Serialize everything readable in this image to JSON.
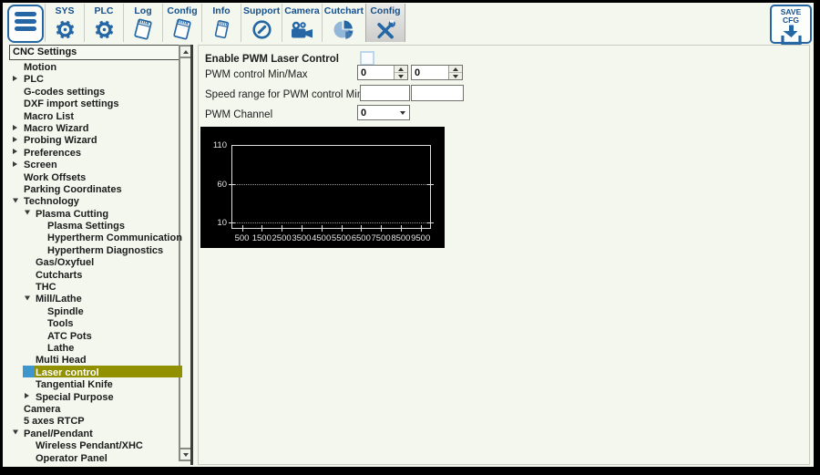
{
  "colors": {
    "accent_blue": "#2566a5",
    "toolbar_label_blue": "#17508c",
    "selection_olive": "#919100",
    "selection_blue": "#3d96cc",
    "app_background": "#f3f7ee",
    "chart_background": "#000000"
  },
  "toolbar": {
    "menu_button": {
      "icon": "menu"
    },
    "buttons": [
      {
        "id": "sys",
        "label": "SYS",
        "icon": "gear"
      },
      {
        "id": "plc",
        "label": "PLC",
        "icon": "gear"
      },
      {
        "id": "log",
        "label": "Log",
        "icon": "notepad"
      },
      {
        "id": "config",
        "label": "Config",
        "icon": "notepad"
      },
      {
        "id": "info",
        "label": "Info",
        "icon": "notepad-small"
      },
      {
        "id": "support",
        "label": "Support",
        "icon": "support-dial"
      },
      {
        "id": "camera",
        "label": "Camera",
        "icon": "camera"
      },
      {
        "id": "cutchart",
        "label": "Cutchart",
        "icon": "pie-chart"
      },
      {
        "id": "config-tools",
        "label": "Config",
        "icon": "tools",
        "selected": true
      }
    ],
    "save_button": {
      "label": "SAVE CFG",
      "icon": "save-arrow"
    }
  },
  "sidebar": {
    "header": "CNC Settings",
    "items": [
      {
        "label": "Motion",
        "level": 0,
        "arrow": null
      },
      {
        "label": "PLC",
        "level": 0,
        "arrow": "right"
      },
      {
        "label": "G-codes settings",
        "level": 0,
        "arrow": null
      },
      {
        "label": "DXF import settings",
        "level": 0,
        "arrow": null
      },
      {
        "label": "Macro List",
        "level": 0,
        "arrow": null
      },
      {
        "label": "Macro Wizard",
        "level": 0,
        "arrow": "right"
      },
      {
        "label": "Probing Wizard",
        "level": 0,
        "arrow": "right"
      },
      {
        "label": "Preferences",
        "level": 0,
        "arrow": "right"
      },
      {
        "label": "Screen",
        "level": 0,
        "arrow": "right"
      },
      {
        "label": "Work Offsets",
        "level": 0,
        "arrow": null
      },
      {
        "label": "Parking Coordinates",
        "level": 0,
        "arrow": null
      },
      {
        "label": "Technology",
        "level": 0,
        "arrow": "down"
      },
      {
        "label": "Plasma Cutting",
        "level": 1,
        "arrow": "down"
      },
      {
        "label": "Plasma Settings",
        "level": 2,
        "arrow": null
      },
      {
        "label": "Hypertherm Communication",
        "level": 2,
        "arrow": null
      },
      {
        "label": "Hypertherm Diagnostics",
        "level": 2,
        "arrow": null
      },
      {
        "label": "Gas/Oxyfuel",
        "level": 1,
        "arrow": null
      },
      {
        "label": "Cutcharts",
        "level": 1,
        "arrow": null
      },
      {
        "label": "THC",
        "level": 1,
        "arrow": null
      },
      {
        "label": "Mill/Lathe",
        "level": 1,
        "arrow": "down"
      },
      {
        "label": "Spindle",
        "level": 2,
        "arrow": null
      },
      {
        "label": "Tools",
        "level": 2,
        "arrow": null
      },
      {
        "label": "ATC Pots",
        "level": 2,
        "arrow": null
      },
      {
        "label": "Lathe",
        "level": 2,
        "arrow": null
      },
      {
        "label": "Multi Head",
        "level": 1,
        "arrow": null
      },
      {
        "label": "Laser control",
        "level": 1,
        "arrow": null,
        "selected": true
      },
      {
        "label": "Tangential Knife",
        "level": 1,
        "arrow": null
      },
      {
        "label": "Special Purpose",
        "level": 1,
        "arrow": "right"
      },
      {
        "label": "Camera",
        "level": 0,
        "arrow": null
      },
      {
        "label": "5 axes RTCP",
        "level": 0,
        "arrow": null
      },
      {
        "label": "Panel/Pendant",
        "level": 0,
        "arrow": "down"
      },
      {
        "label": "Wireless Pendant/XHC",
        "level": 1,
        "arrow": null
      },
      {
        "label": "Operator Panel",
        "level": 1,
        "arrow": null
      }
    ]
  },
  "panel": {
    "enable_label": "Enable PWM Laser Control",
    "enable_checked": false,
    "pwm_minmax_label": "PWM control Min/Max",
    "pwm_min": "0",
    "pwm_max": "0",
    "speed_range_label": "Speed range for PWM control Min/Max",
    "speed_min": "",
    "speed_max": "",
    "pwm_channel_label": "PWM Channel",
    "pwm_channel_value": "0"
  },
  "chart_data": {
    "type": "line",
    "title": "",
    "x_tick_labels": [
      500,
      1500,
      2500,
      3500,
      4500,
      5500,
      6500,
      7500,
      8500,
      9500
    ],
    "y_tick_labels": [
      110,
      60,
      10
    ],
    "x_range": [
      0,
      10000
    ],
    "y_range": [
      0,
      110
    ],
    "grid": "dotted horizontal lines at y=60 and y=10",
    "legend": "none",
    "series": []
  }
}
